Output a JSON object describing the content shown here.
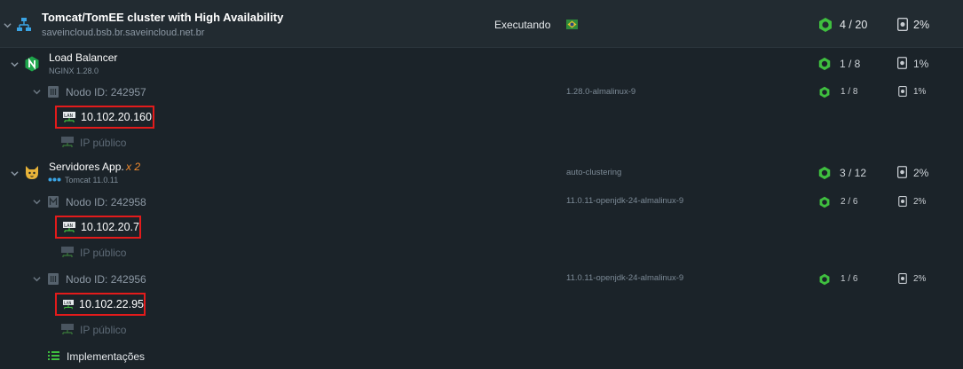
{
  "environment": {
    "title": "Tomcat/TomEE cluster with High Availability",
    "domain": "saveincloud.bsb.br.saveincloud.net.br",
    "status": "Executando",
    "region_flag": "brazil-flag-icon",
    "cloudlets": "4 / 20",
    "disk": "2%"
  },
  "load_balancer": {
    "title": "Load Balancer",
    "version": "NGINX 1.28.0",
    "cloudlets": "1 / 8",
    "disk": "1%",
    "node": {
      "label": "Nodo ID: 242957",
      "tag": "1.28.0-almalinux-9",
      "cloudlets": "1 / 8",
      "disk": "1%",
      "ip": "10.102.20.160",
      "public_ip": "IP público"
    }
  },
  "app_servers": {
    "title": "Servidores App.",
    "multiplier": "x 2",
    "version": "Tomcat 11.0.11",
    "tag": "auto-clustering",
    "cloudlets": "3 / 12",
    "disk": "2%",
    "nodes": [
      {
        "label": "Nodo ID: 242958",
        "tag": "11.0.11-openjdk-24-almalinux-9",
        "cloudlets": "2 / 6",
        "disk": "2%",
        "ip": "10.102.20.7",
        "public_ip": "IP público"
      },
      {
        "label": "Nodo ID: 242956",
        "tag": "11.0.11-openjdk-24-almalinux-9",
        "cloudlets": "1 / 6",
        "disk": "2%",
        "ip": "10.102.22.95",
        "public_ip": "IP público"
      }
    ]
  },
  "deployments": {
    "label": "Implementações"
  },
  "colors": {
    "background": "#1b2329",
    "env_row": "#222b31",
    "cloudlet_green": "#3fbf3f",
    "highlight_red": "#e31b1b",
    "multiplier_orange": "#f08a2e"
  }
}
